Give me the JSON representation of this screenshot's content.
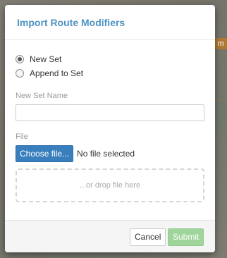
{
  "background": {
    "badge_letter": "m"
  },
  "dialog": {
    "title": "Import Route Modifiers",
    "options": [
      {
        "label": "New Set",
        "checked": true
      },
      {
        "label": "Append to Set",
        "checked": false
      }
    ],
    "set_name_label": "New Set Name",
    "set_name_value": "",
    "file_label": "File",
    "choose_button": "Choose file...",
    "file_status": "No file selected",
    "dropzone_text": "...or drop file here",
    "cancel_button": "Cancel",
    "submit_button": "Submit"
  },
  "colors": {
    "title": "#4f93c4",
    "choose_button_bg": "#3a7fbd",
    "submit_button_bg": "#9fd59a"
  }
}
